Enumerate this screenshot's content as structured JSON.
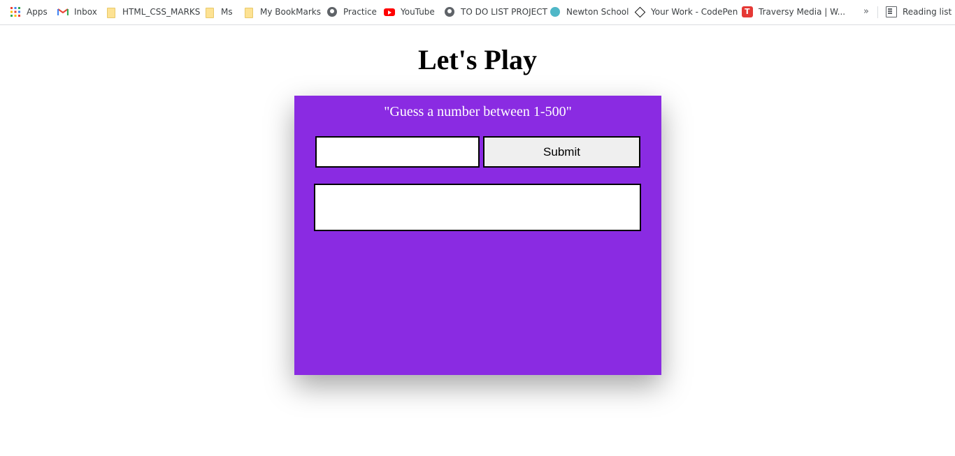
{
  "bookmarks_bar": {
    "items": [
      {
        "label": "Apps",
        "icon": "apps-grid-icon"
      },
      {
        "label": "Inbox",
        "icon": "gmail-icon"
      },
      {
        "label": "HTML_CSS_MARKS",
        "icon": "folder-icon"
      },
      {
        "label": "Ms",
        "icon": "folder-icon"
      },
      {
        "label": "My BookMarks",
        "icon": "folder-icon"
      },
      {
        "label": "Practice",
        "icon": "globe-icon"
      },
      {
        "label": "YouTube",
        "icon": "youtube-icon"
      },
      {
        "label": "TO DO LIST PROJECT",
        "icon": "globe-icon"
      },
      {
        "label": "Newton School",
        "icon": "newton-school-icon"
      },
      {
        "label": "Your Work - CodePen",
        "icon": "codepen-icon"
      },
      {
        "label": "Traversy Media | W...",
        "icon": "traversy-media-icon"
      }
    ],
    "overflow_label": "»",
    "reading_list_label": "Reading list"
  },
  "page": {
    "title": "Let's Play"
  },
  "game": {
    "prompt": "\"Guess a number between 1-500\"",
    "input_value": "",
    "submit_label": "Submit",
    "result_text": "",
    "card_color": "#8a2be2"
  }
}
